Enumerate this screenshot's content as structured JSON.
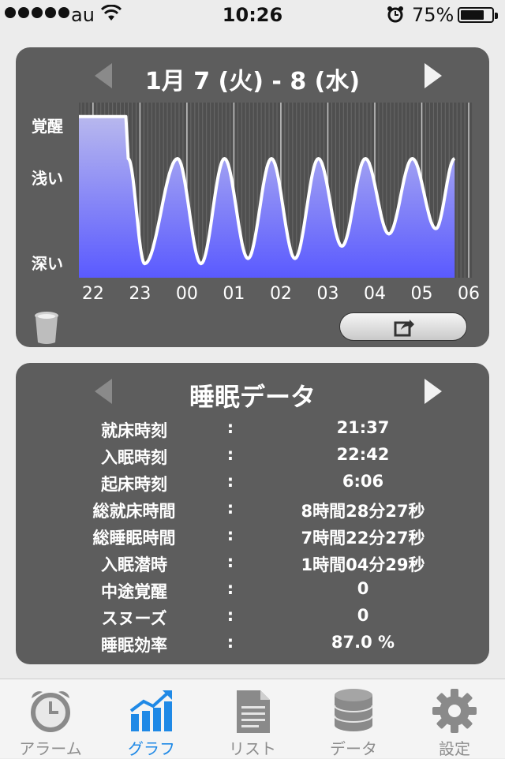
{
  "status": {
    "carrier": "au",
    "time": "10:26",
    "battery": "75%",
    "battery_fraction": 0.75,
    "icons": [
      "signal-dots-icon",
      "wifi-icon",
      "alarm-clock-icon",
      "battery-icon"
    ]
  },
  "graph": {
    "title": "1月 7 (火) - 8 (水)",
    "y_labels": {
      "awake": "覚醒",
      "light": "浅い",
      "deep": "深い"
    },
    "x_ticks": [
      "22",
      "23",
      "00",
      "01",
      "02",
      "03",
      "04",
      "05",
      "06"
    ],
    "fill_color_top": "#b8b8ee",
    "fill_color_bottom": "#5a5aff"
  },
  "chart_data": {
    "type": "area",
    "y_categories": [
      "深い",
      "浅い",
      "覚醒"
    ],
    "x_tick_labels": [
      "22",
      "23",
      "00",
      "01",
      "02",
      "03",
      "04",
      "05",
      "06"
    ],
    "x_range_hours": [
      21.7,
      30.1
    ],
    "y_range": [
      0,
      1
    ],
    "awake_until_hour": 22.7,
    "sleep_waves": [
      {
        "peak_hour": 23.8,
        "trough_hour": 23.1,
        "trough": 0.08,
        "peak": 0.68
      },
      {
        "peak_hour": 24.8,
        "trough_hour": 24.3,
        "trough": 0.08,
        "peak": 0.68
      },
      {
        "peak_hour": 25.8,
        "trough_hour": 25.3,
        "trough": 0.11,
        "peak": 0.68
      },
      {
        "peak_hour": 26.8,
        "trough_hour": 26.3,
        "trough": 0.11,
        "peak": 0.68
      },
      {
        "peak_hour": 27.8,
        "trough_hour": 27.3,
        "trough": 0.18,
        "peak": 0.68
      },
      {
        "peak_hour": 28.8,
        "trough_hour": 28.3,
        "trough": 0.25,
        "peak": 0.68
      },
      {
        "peak_hour": 29.7,
        "trough_hour": 29.3,
        "trough": 0.28,
        "peak": 0.68
      }
    ],
    "grid": true
  },
  "sleep_data": {
    "title": "睡眠データ",
    "colon": ":",
    "rows": [
      {
        "label": "就床時刻",
        "value": "21:37"
      },
      {
        "label": "入眠時刻",
        "value": "22:42"
      },
      {
        "label": "起床時刻",
        "value": "6:06"
      },
      {
        "label": "総就床時間",
        "value": "8時間28分27秒"
      },
      {
        "label": "総睡眠時間",
        "value": "7時間22分27秒"
      },
      {
        "label": "入眠潜時",
        "value": "1時間04分29秒"
      },
      {
        "label": "中途覚醒",
        "value": "0"
      },
      {
        "label": "スヌーズ",
        "value": "0"
      },
      {
        "label": "睡眠効率",
        "value": "87.0 %"
      }
    ]
  },
  "tabs": [
    {
      "label": "アラーム",
      "icon": "alarm-clock-icon",
      "active": false
    },
    {
      "label": "グラフ",
      "icon": "chart-icon",
      "active": true
    },
    {
      "label": "リスト",
      "icon": "document-list-icon",
      "active": false
    },
    {
      "label": "データ",
      "icon": "database-icon",
      "active": false
    },
    {
      "label": "設定",
      "icon": "gear-icon",
      "active": false
    }
  ],
  "colors": {
    "panel": "#5d5d5d",
    "active_tab": "#1f89e6",
    "inactive_tab": "#8d8d8d"
  }
}
